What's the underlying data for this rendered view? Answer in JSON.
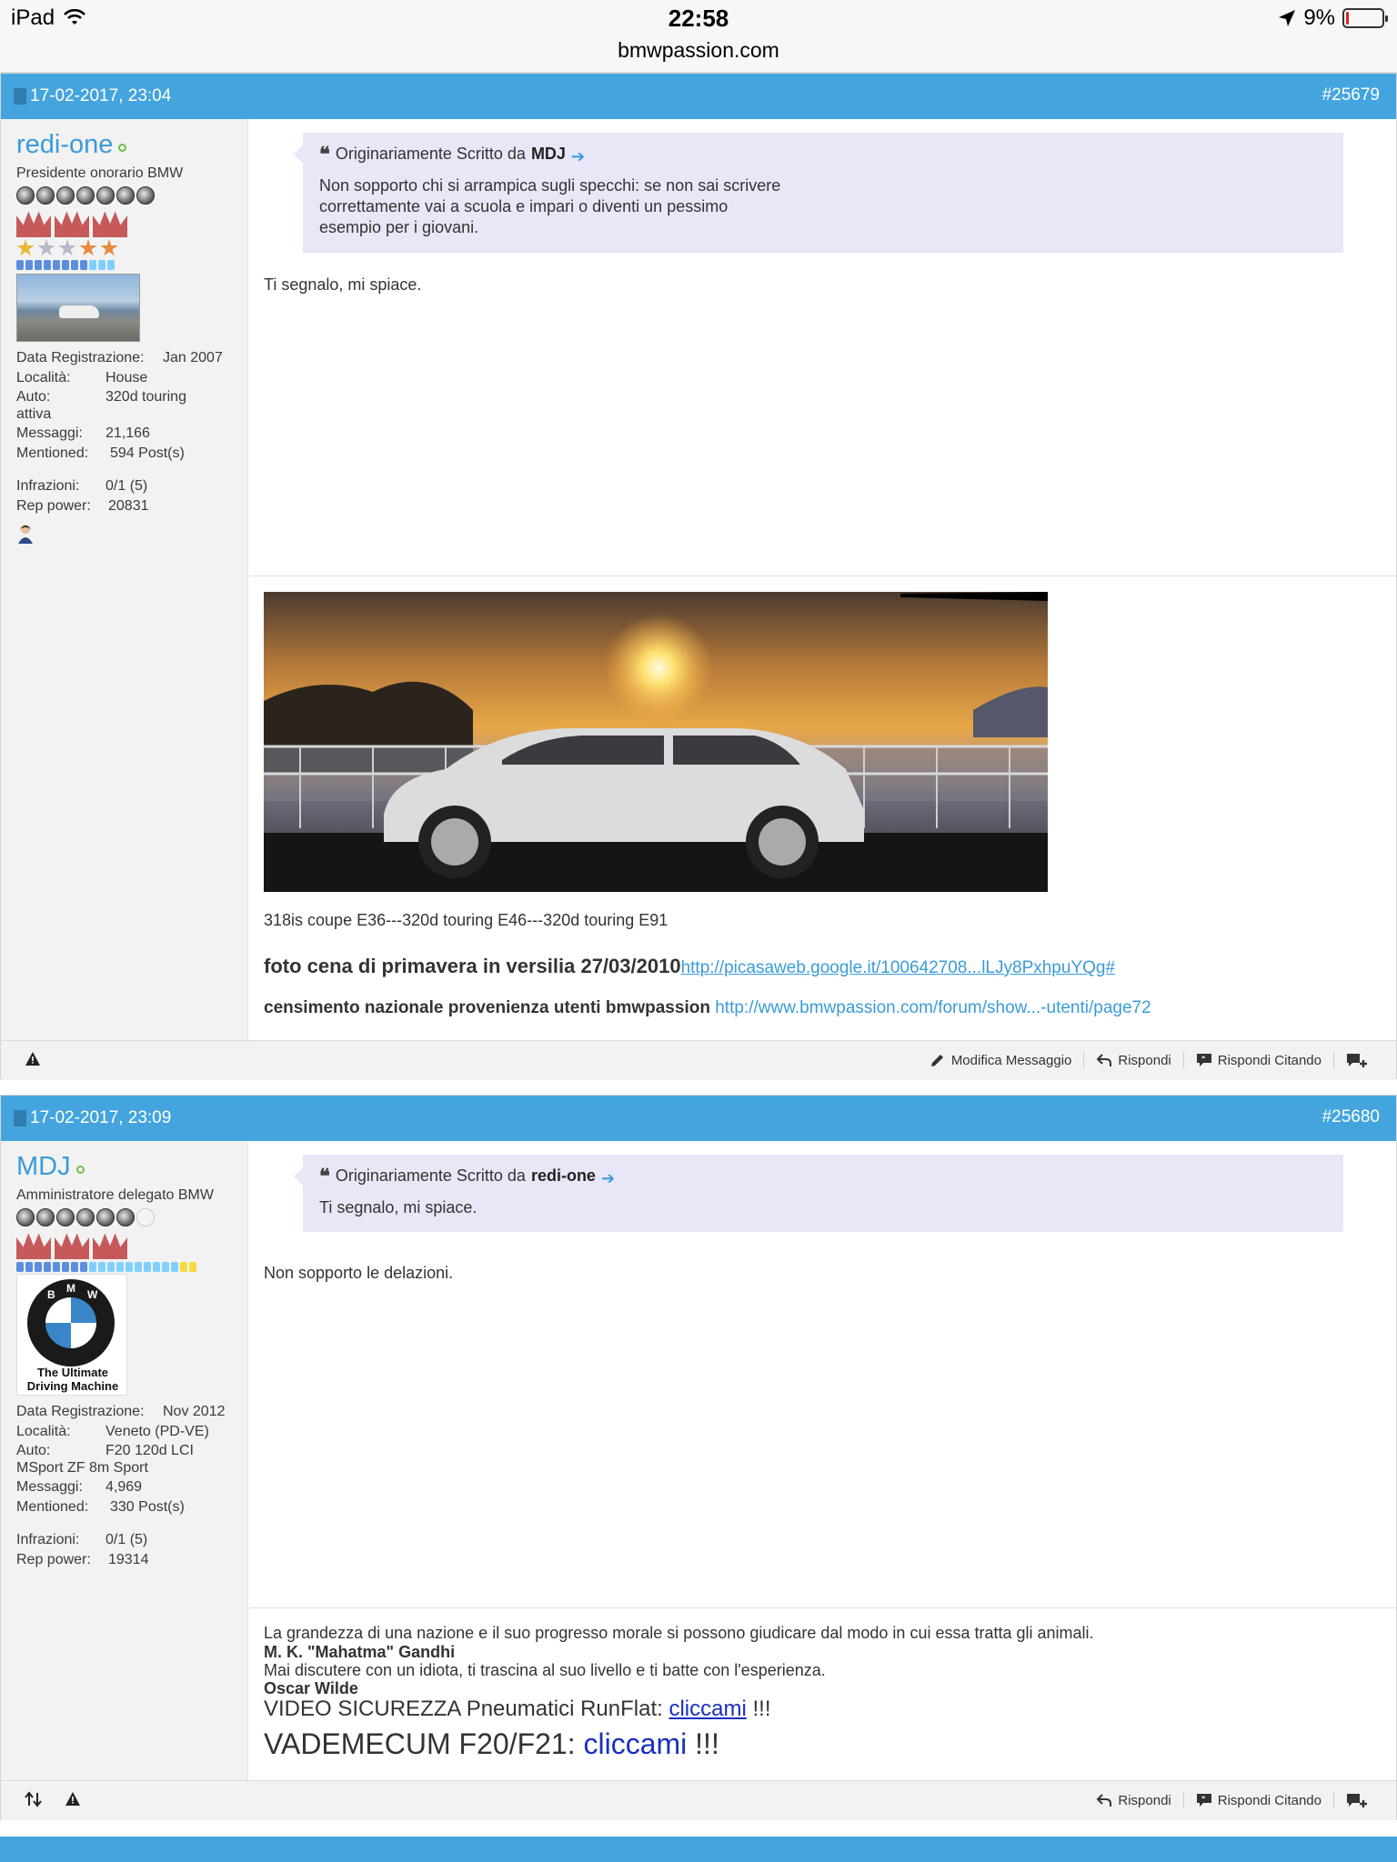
{
  "statusbar": {
    "device": "iPad",
    "time": "22:58",
    "url": "bmwpassion.com",
    "battery": "9%",
    "battery_level": 0.09
  },
  "posts": [
    {
      "date": "17-02-2017, 23:04",
      "number": "#25679",
      "user": {
        "name": "redi-one",
        "title": "Presidente onorario BMW",
        "stats": [
          {
            "k": "Data Registrazione:",
            "v": "Jan 2007"
          },
          {
            "k": "Località:",
            "v": "House"
          },
          {
            "k": "Auto:",
            "v": "320d touring"
          },
          {
            "k": "",
            "v": "attiva"
          },
          {
            "k": "Messaggi:",
            "v": "21,166"
          },
          {
            "k": "Mentioned:",
            "v": "594 Post(s)"
          }
        ],
        "stats2": [
          {
            "k": "Infrazioni:",
            "v": "0/1 (5)"
          },
          {
            "k": "Rep power:",
            "v": "20831"
          }
        ]
      },
      "quote": {
        "prefix": "Originariamente Scritto da",
        "author": "MDJ",
        "text": "Non sopporto chi si arrampica sugli specchi: se non sai scrivere correttamente vai a scuola e impari o diventi un pessimo esempio per i giovani."
      },
      "message": "Ti segnalo, mi spiace.",
      "signature": {
        "line1": "318is coupe E36---320d touring E46---320d touring E91",
        "line2_bold": "foto cena di primavera in versilia 27/03/2010",
        "line2_link": "http://picasaweb.google.it/100642708...lLJy8PxhpuYQg#",
        "line3_bold": "censimento nazionale provenienza utenti bmwpassion",
        "line3_link": "http://www.bmwpassion.com/forum/show...-utenti/page72"
      },
      "footer": {
        "edit": "Modifica Messaggio",
        "reply": "Rispondi",
        "reply_quote": "Rispondi Citando"
      }
    },
    {
      "date": "17-02-2017, 23:09",
      "number": "#25680",
      "user": {
        "name": "MDJ",
        "title": "Amministratore delegato BMW",
        "avatar_caption_1": "The Ultimate",
        "avatar_caption_2": "Driving Machine",
        "stats": [
          {
            "k": "Data Registrazione:",
            "v": "Nov 2012"
          },
          {
            "k": "Località:",
            "v": "Veneto (PD-VE)"
          },
          {
            "k": "Auto:",
            "v": "F20 120d LCI"
          },
          {
            "k": "",
            "v": "MSport ZF 8m Sport"
          },
          {
            "k": "Messaggi:",
            "v": "4,969"
          },
          {
            "k": "Mentioned:",
            "v": "330 Post(s)"
          }
        ],
        "stats2": [
          {
            "k": "Infrazioni:",
            "v": "0/1 (5)"
          },
          {
            "k": "Rep power:",
            "v": "19314"
          }
        ]
      },
      "quote": {
        "prefix": "Originariamente Scritto da",
        "author": "redi-one",
        "text": "Ti segnalo, mi spiace."
      },
      "message": "Non sopporto le delazioni.",
      "signature": {
        "line1": "La grandezza di una nazione e il suo progresso morale si possono giudicare dal modo in cui essa tratta gli animali.",
        "line2": "M. K. \"Mahatma\" Gandhi",
        "line3": "Mai discutere con un idiota, ti trascina al suo livello e ti batte con l'esperienza.",
        "line4": "Oscar Wilde",
        "line5_text": "VIDEO SICUREZZA Pneumatici RunFlat:",
        "line5_link": "cliccami",
        "line5_tail": "!!!",
        "line6_text": "VADEMECUM F20/F21:",
        "line6_link": "cliccami",
        "line6_tail": "!!!"
      },
      "footer": {
        "reply": "Rispondi",
        "reply_quote": "Rispondi Citando"
      }
    }
  ],
  "colors": {
    "header_blue": "#44a5de",
    "link_blue": "#3a9bd9",
    "quote_bg": "#e7e7f7",
    "online_green": "#6cc04a"
  },
  "icons": [
    "wifi-icon",
    "location-arrow-icon",
    "battery-icon",
    "document-icon",
    "quote-icon",
    "arrow-right-icon",
    "warning-icon",
    "pencil-icon",
    "reply-icon",
    "reply-quote-icon",
    "multi-quote-icon",
    "sort-icon",
    "user-icon"
  ]
}
